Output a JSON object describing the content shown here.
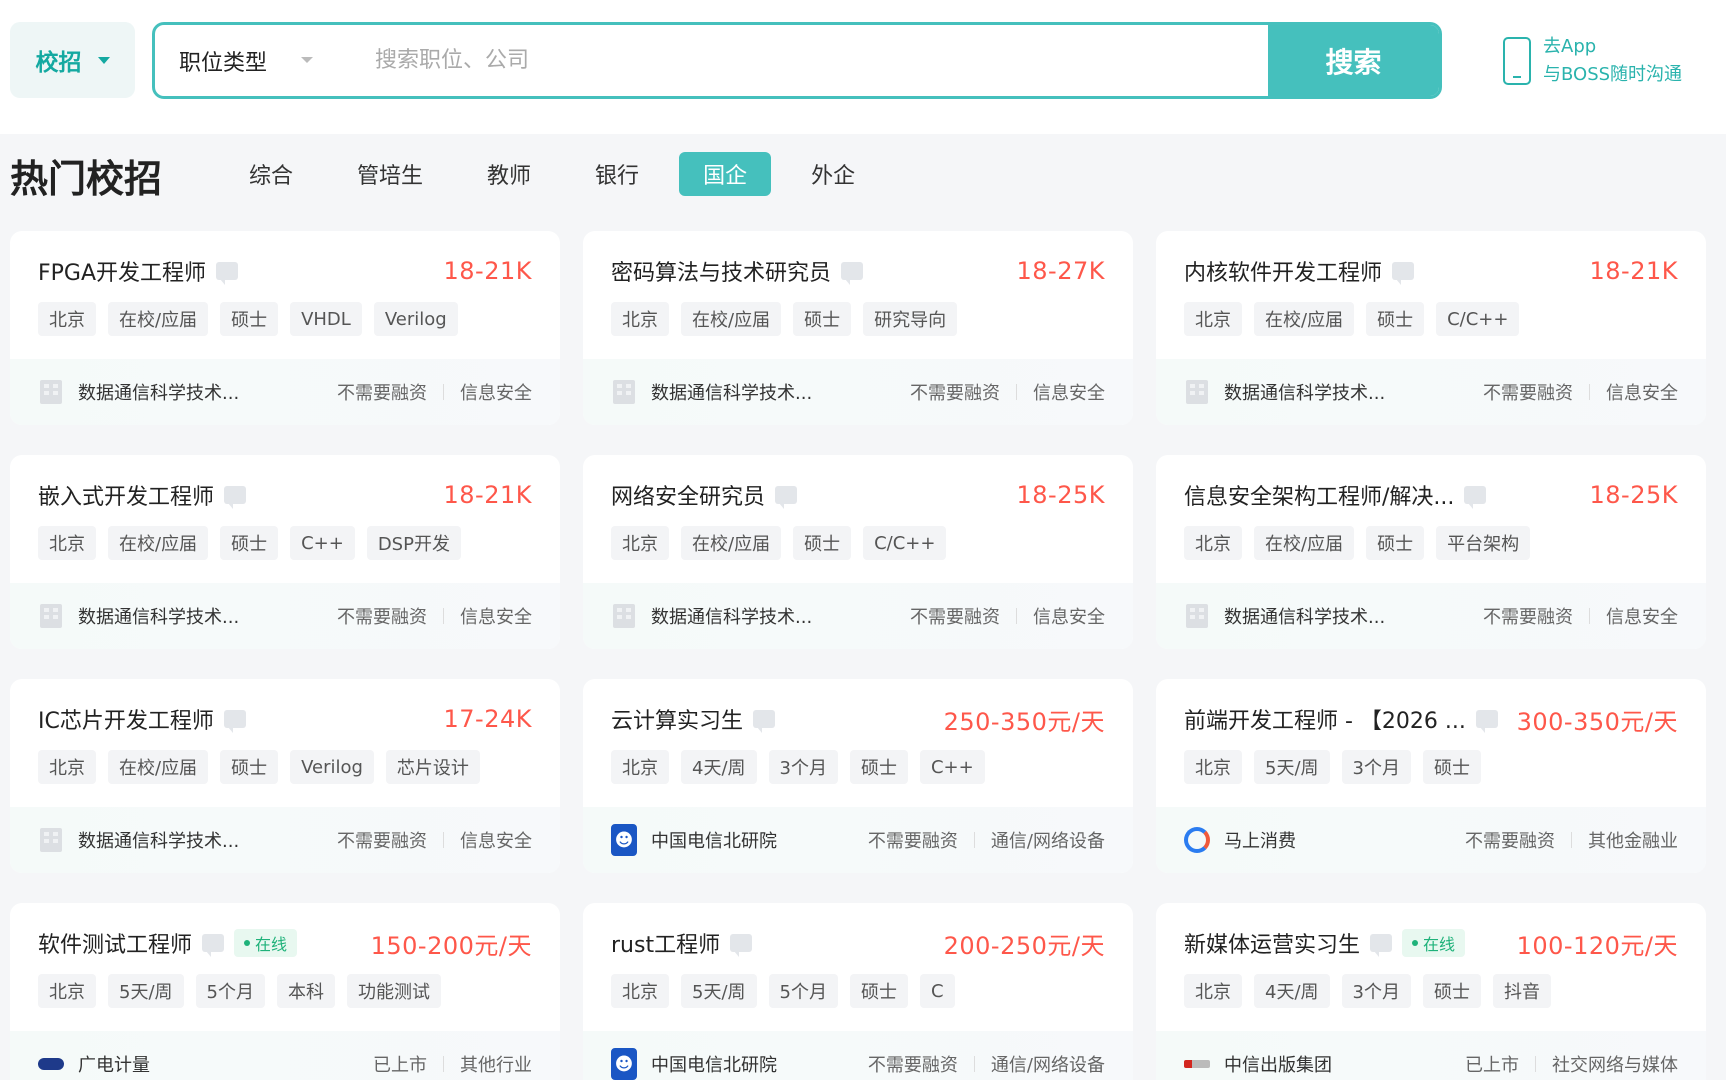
{
  "topbar": {
    "campus_label": "校招",
    "job_type_label": "职位类型",
    "search_placeholder": "搜索职位、公司",
    "search_button": "搜索",
    "promo_line1": "去App",
    "promo_line2": "与BOSS随时沟通"
  },
  "section": {
    "title": "热门校招",
    "tabs": [
      {
        "label": "综合",
        "active": false
      },
      {
        "label": "管培生",
        "active": false
      },
      {
        "label": "教师",
        "active": false
      },
      {
        "label": "银行",
        "active": false
      },
      {
        "label": "国企",
        "active": true
      },
      {
        "label": "外企",
        "active": false
      }
    ]
  },
  "colors": {
    "accent": "#45c0bd",
    "salary": "#fe574a",
    "online": "#1fb27a"
  },
  "jobs": [
    {
      "title": "FPGA开发工程师",
      "online": false,
      "salary": "18-21K",
      "tags": [
        "北京",
        "在校/应届",
        "硕士",
        "VHDL",
        "Verilog"
      ],
      "company": "数据通信科学技术...",
      "logo": "building-icon",
      "funding": "不需要融资",
      "industry": "信息安全"
    },
    {
      "title": "密码算法与技术研究员",
      "online": false,
      "salary": "18-27K",
      "tags": [
        "北京",
        "在校/应届",
        "硕士",
        "研究导向"
      ],
      "company": "数据通信科学技术...",
      "logo": "building-icon",
      "funding": "不需要融资",
      "industry": "信息安全"
    },
    {
      "title": "内核软件开发工程师",
      "online": false,
      "salary": "18-21K",
      "tags": [
        "北京",
        "在校/应届",
        "硕士",
        "C/C++"
      ],
      "company": "数据通信科学技术...",
      "logo": "building-icon",
      "funding": "不需要融资",
      "industry": "信息安全"
    },
    {
      "title": "嵌入式开发工程师",
      "online": false,
      "salary": "18-21K",
      "tags": [
        "北京",
        "在校/应届",
        "硕士",
        "C++",
        "DSP开发"
      ],
      "company": "数据通信科学技术...",
      "logo": "building-icon",
      "funding": "不需要融资",
      "industry": "信息安全"
    },
    {
      "title": "网络安全研究员",
      "online": false,
      "salary": "18-25K",
      "tags": [
        "北京",
        "在校/应届",
        "硕士",
        "C/C++"
      ],
      "company": "数据通信科学技术...",
      "logo": "building-icon",
      "funding": "不需要融资",
      "industry": "信息安全"
    },
    {
      "title": "信息安全架构工程师/解决...",
      "online": false,
      "salary": "18-25K",
      "tags": [
        "北京",
        "在校/应届",
        "硕士",
        "平台架构"
      ],
      "company": "数据通信科学技术...",
      "logo": "building-icon",
      "funding": "不需要融资",
      "industry": "信息安全"
    },
    {
      "title": "IC芯片开发工程师",
      "online": false,
      "salary": "17-24K",
      "tags": [
        "北京",
        "在校/应届",
        "硕士",
        "Verilog",
        "芯片设计"
      ],
      "company": "数据通信科学技术...",
      "logo": "building-icon",
      "funding": "不需要融资",
      "industry": "信息安全"
    },
    {
      "title": "云计算实习生",
      "online": false,
      "salary": "250-350元/天",
      "tags": [
        "北京",
        "4天/周",
        "3个月",
        "硕士",
        "C++"
      ],
      "company": "中国电信北研院",
      "logo": "china-telecom-logo",
      "funding": "不需要融资",
      "industry": "通信/网络设备"
    },
    {
      "title": "前端开发工程师 - 【2026 ...",
      "online": false,
      "salary": "300-350元/天",
      "tags": [
        "北京",
        "5天/周",
        "3个月",
        "硕士"
      ],
      "company": "马上消费",
      "logo": "mashang-logo",
      "funding": "不需要融资",
      "industry": "其他金融业"
    },
    {
      "title": "软件测试工程师",
      "online": true,
      "salary": "150-200元/天",
      "tags": [
        "北京",
        "5天/周",
        "5个月",
        "本科",
        "功能测试"
      ],
      "company": "广电计量",
      "logo": "grgt-logo",
      "funding": "已上市",
      "industry": "其他行业"
    },
    {
      "title": "rust工程师",
      "online": false,
      "salary": "200-250元/天",
      "tags": [
        "北京",
        "5天/周",
        "5个月",
        "硕士",
        "C"
      ],
      "company": "中国电信北研院",
      "logo": "china-telecom-logo",
      "funding": "不需要融资",
      "industry": "通信/网络设备"
    },
    {
      "title": "新媒体运营实习生",
      "online": true,
      "salary": "100-120元/天",
      "tags": [
        "北京",
        "4天/周",
        "3个月",
        "硕士",
        "抖音"
      ],
      "company": "中信出版集团",
      "logo": "citic-logo",
      "funding": "已上市",
      "industry": "社交网络与媒体"
    }
  ],
  "online_label": "在线"
}
